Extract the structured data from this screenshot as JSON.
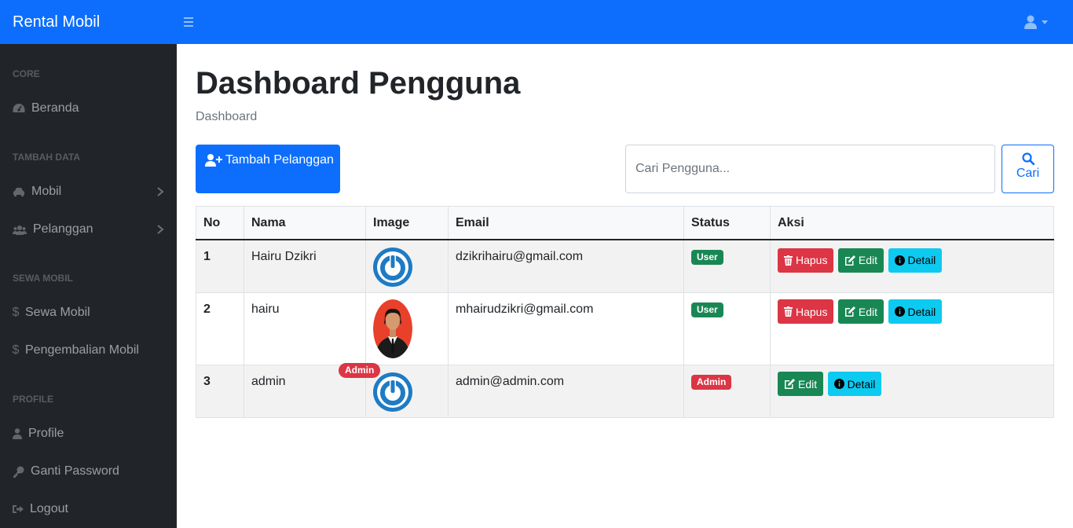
{
  "app": {
    "brand": "Rental Mobil"
  },
  "sidebar": {
    "sections": [
      {
        "heading": "CORE",
        "items": [
          {
            "label": "Beranda",
            "icon": "tachometer-icon"
          }
        ]
      },
      {
        "heading": "TAMBAH DATA",
        "items": [
          {
            "label": "Mobil",
            "icon": "car-icon"
          },
          {
            "label": "Pelanggan",
            "icon": "users-icon"
          }
        ]
      },
      {
        "heading": "SEWA MOBIL",
        "items": [
          {
            "label": "Sewa Mobil",
            "icon": "dollar-icon"
          },
          {
            "label": "Pengembalian Mobil",
            "icon": "dollar-icon"
          }
        ]
      },
      {
        "heading": "PROFILE",
        "items": [
          {
            "label": "Profile",
            "icon": "user-icon"
          },
          {
            "label": "Ganti Password",
            "icon": "key-icon"
          },
          {
            "label": "Logout",
            "icon": "sign-out-icon"
          }
        ]
      }
    ]
  },
  "main": {
    "title": "Dashboard Pengguna",
    "breadcrumb": "Dashboard",
    "add_button": "Tambah Pelanggan",
    "search": {
      "placeholder": "Cari Pengguna...",
      "button": "Cari"
    }
  },
  "table": {
    "headers": [
      "No",
      "Nama",
      "Image",
      "Email",
      "Status",
      "Aksi"
    ],
    "rows": [
      {
        "no": "1",
        "nama": "Hairu Dzikri",
        "email": "dzikrihairu@gmail.com",
        "status": "User",
        "image": "default-avatar-logo"
      },
      {
        "no": "2",
        "nama": "hairu",
        "email": "mhairudzikri@gmail.com",
        "status": "User",
        "image": "user-photo"
      },
      {
        "no": "3",
        "nama": "admin",
        "email": "admin@admin.com",
        "status": "Admin",
        "image": "default-avatar-logo",
        "tag": "Admin"
      }
    ],
    "actions": {
      "delete": "Hapus",
      "edit": "Edit",
      "detail": "Detail"
    }
  },
  "colors": {
    "primary": "#0d6efd",
    "danger": "#dc3545",
    "success": "#198754",
    "info": "#0dcaf0",
    "sidebar": "#212529"
  }
}
